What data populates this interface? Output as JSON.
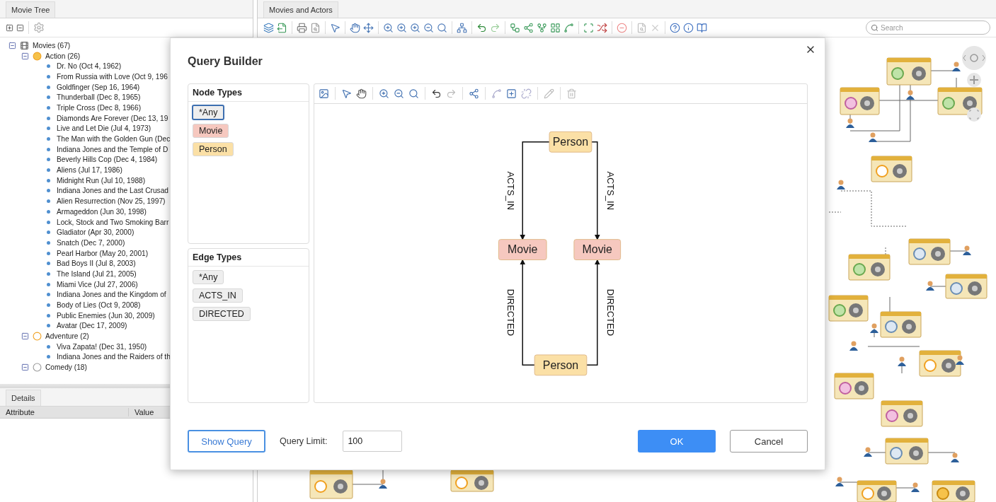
{
  "movie_tree": {
    "title": "Movie Tree",
    "tree": [
      {
        "label": "Movies (67)",
        "expanded": true,
        "children": [
          {
            "label": "Action (26)",
            "expanded": true,
            "children": [
              {
                "label": "Dr. No (Oct 4, 1962)"
              },
              {
                "label": "From Russia with Love (Oct 9, 196"
              },
              {
                "label": "Goldfinger (Sep 16, 1964)"
              },
              {
                "label": "Thunderball (Dec 8, 1965)"
              },
              {
                "label": "Triple Cross (Dec 8, 1966)"
              },
              {
                "label": "Diamonds Are Forever (Dec 13, 19"
              },
              {
                "label": "Live and Let Die (Jul 4, 1973)"
              },
              {
                "label": "The Man with the Golden Gun (Dec"
              },
              {
                "label": "Indiana Jones and the Temple of D"
              },
              {
                "label": "Beverly Hills Cop (Dec 4, 1984)"
              },
              {
                "label": "Aliens (Jul 17, 1986)"
              },
              {
                "label": "Midnight Run (Jul 10, 1988)"
              },
              {
                "label": "Indiana Jones and the Last Crusad"
              },
              {
                "label": "Alien Resurrection (Nov 25, 1997)"
              },
              {
                "label": "Armageddon (Jun 30, 1998)"
              },
              {
                "label": "Lock, Stock and Two Smoking Barr"
              },
              {
                "label": "Gladiator (Apr 30, 2000)"
              },
              {
                "label": "Snatch (Dec 7, 2000)"
              },
              {
                "label": "Pearl Harbor (May 20, 2001)"
              },
              {
                "label": "Bad Boys II (Jul 8, 2003)"
              },
              {
                "label": "The Island (Jul 21, 2005)"
              },
              {
                "label": "Miami Vice (Jul 27, 2006)"
              },
              {
                "label": "Indiana Jones and the Kingdom of"
              },
              {
                "label": "Body of Lies (Oct 9, 2008)"
              },
              {
                "label": "Public Enemies (Jun 30, 2009)"
              },
              {
                "label": "Avatar (Dec 17, 2009)"
              }
            ]
          },
          {
            "label": "Adventure (2)",
            "expanded": true,
            "children": [
              {
                "label": "Viva Zapata! (Dec 31, 1950)"
              },
              {
                "label": "Indiana Jones and the Raiders of th"
              }
            ]
          },
          {
            "label": "Comedy (18)",
            "expanded": true
          }
        ]
      }
    ]
  },
  "details": {
    "title": "Details",
    "columns": [
      "Attribute",
      "Value"
    ]
  },
  "graph_panel": {
    "title": "Movies and Actors",
    "search": {
      "placeholder": "Search"
    }
  },
  "dialog": {
    "title": "Query Builder",
    "node_types": {
      "title": "Node Types",
      "items": [
        {
          "label": "*Any",
          "selected": true,
          "color": "#eeeeee"
        },
        {
          "label": "Movie",
          "selected": false,
          "color": "#f6c8bf"
        },
        {
          "label": "Person",
          "selected": false,
          "color": "#fbe0a6"
        }
      ]
    },
    "edge_types": {
      "title": "Edge Types",
      "items": [
        {
          "label": "*Any",
          "selected": false
        },
        {
          "label": "ACTS_IN",
          "selected": false
        },
        {
          "label": "DIRECTED",
          "selected": false
        }
      ]
    },
    "query": {
      "nodes": [
        {
          "label": "Person",
          "color": "#fbe0a6"
        },
        {
          "label": "Movie",
          "color": "#f6c8bf"
        },
        {
          "label": "Movie",
          "color": "#f6c8bf"
        },
        {
          "label": "Person",
          "color": "#fbe0a6"
        }
      ],
      "edges": [
        {
          "label": "ACTS_IN"
        },
        {
          "label": "ACTS_IN"
        },
        {
          "label": "DIRECTED"
        },
        {
          "label": "DIRECTED"
        }
      ]
    },
    "footer": {
      "show_query": "Show Query",
      "limit_label": "Query Limit:",
      "limit_value": "100",
      "ok": "OK",
      "cancel": "Cancel"
    }
  }
}
